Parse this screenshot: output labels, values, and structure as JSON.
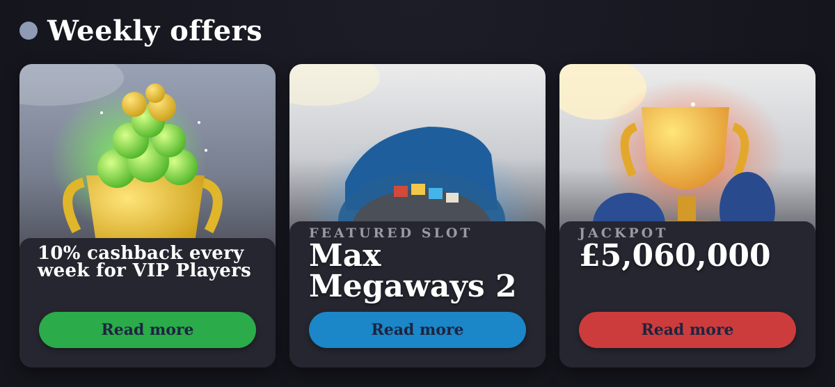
{
  "header": {
    "title": "Weekly offers",
    "dot_color": "#8e9bb3"
  },
  "cards": [
    {
      "art": "coins-trophy-icon",
      "text": "10% cashback every week for VIP Players",
      "button_label": "Read more",
      "button_color": "#2bab4a"
    },
    {
      "art": "slot-reel-icon",
      "eyebrow": "FEATURED SLOT",
      "title": "Max Megaways 2",
      "button_label": "Read more",
      "button_color": "#1b86c8"
    },
    {
      "art": "trophy-icon",
      "eyebrow": "JACKPOT",
      "title": "£5,060,000",
      "button_label": "Read more",
      "button_color": "#cc3c3c"
    }
  ]
}
